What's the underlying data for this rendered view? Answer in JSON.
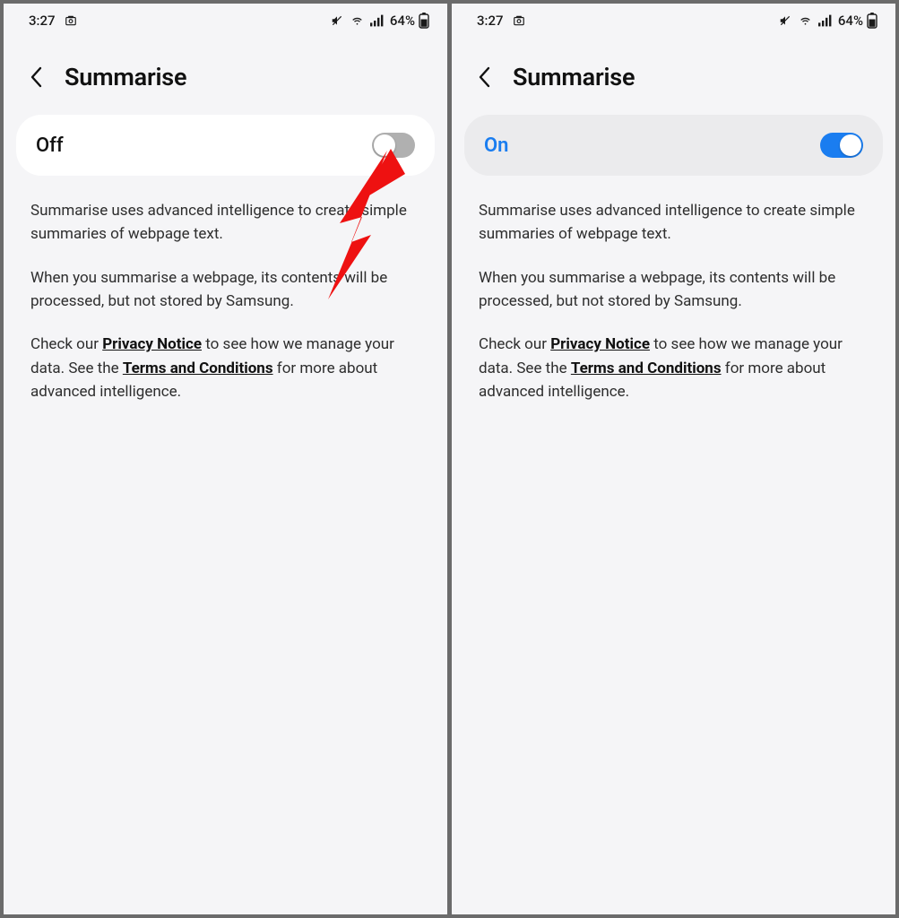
{
  "statusbar": {
    "time": "3:27",
    "battery_pct": "64%"
  },
  "header": {
    "title": "Summarise"
  },
  "toggle": {
    "off_label": "Off",
    "on_label": "On"
  },
  "body": {
    "p1": "Summarise uses advanced intelligence to create simple summaries of webpage text.",
    "p2": "When you summarise a webpage, its contents will be processed, but not stored by Samsung.",
    "p3_a": "Check our ",
    "privacy_link": "Privacy Notice",
    "p3_b": " to see how we manage your data. See the ",
    "terms_link": "Terms and Conditions",
    "p3_c": " for more about advanced intelligence."
  }
}
